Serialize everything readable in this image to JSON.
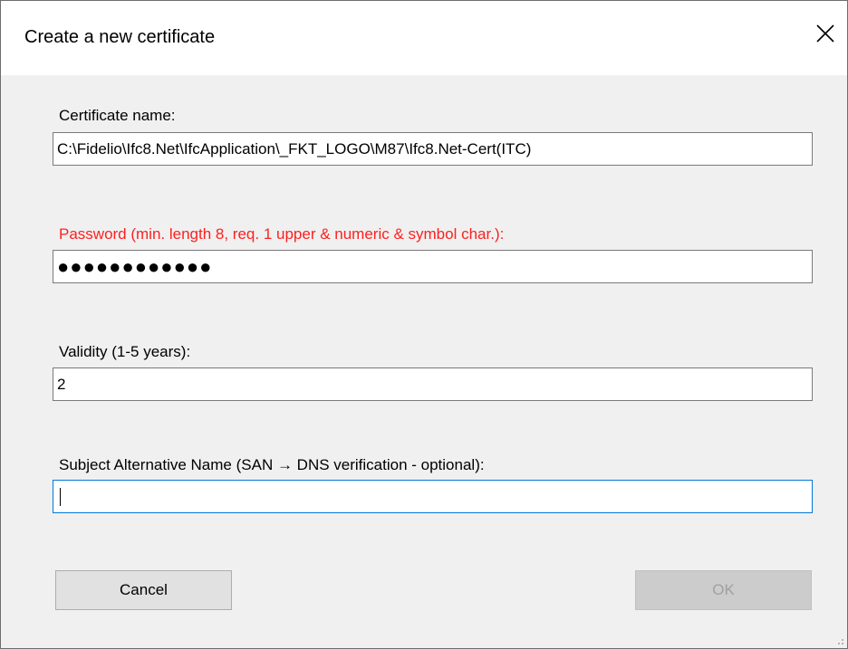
{
  "dialog": {
    "title": "Create a new certificate",
    "close_icon": "close-icon"
  },
  "fields": {
    "certificate_name": {
      "label": "Certificate name:",
      "value": "C:\\Fidelio\\Ifc8.Net\\IfcApplication\\_FKT_LOGO\\M87\\Ifc8.Net-Cert(ITC)"
    },
    "password": {
      "label": "Password (min. length 8, req. 1 upper & numeric & symbol char.):",
      "masked_value": "●●●●●●●●●●●●",
      "label_color": "#ff1f1f"
    },
    "validity": {
      "label": "Validity (1-5 years):",
      "value": "2"
    },
    "san": {
      "label": "Subject Alternative Name (SAN → DNS verification - optional):",
      "value": "",
      "focus_color": "#0078d7"
    }
  },
  "buttons": {
    "cancel": "Cancel",
    "ok": "OK"
  }
}
